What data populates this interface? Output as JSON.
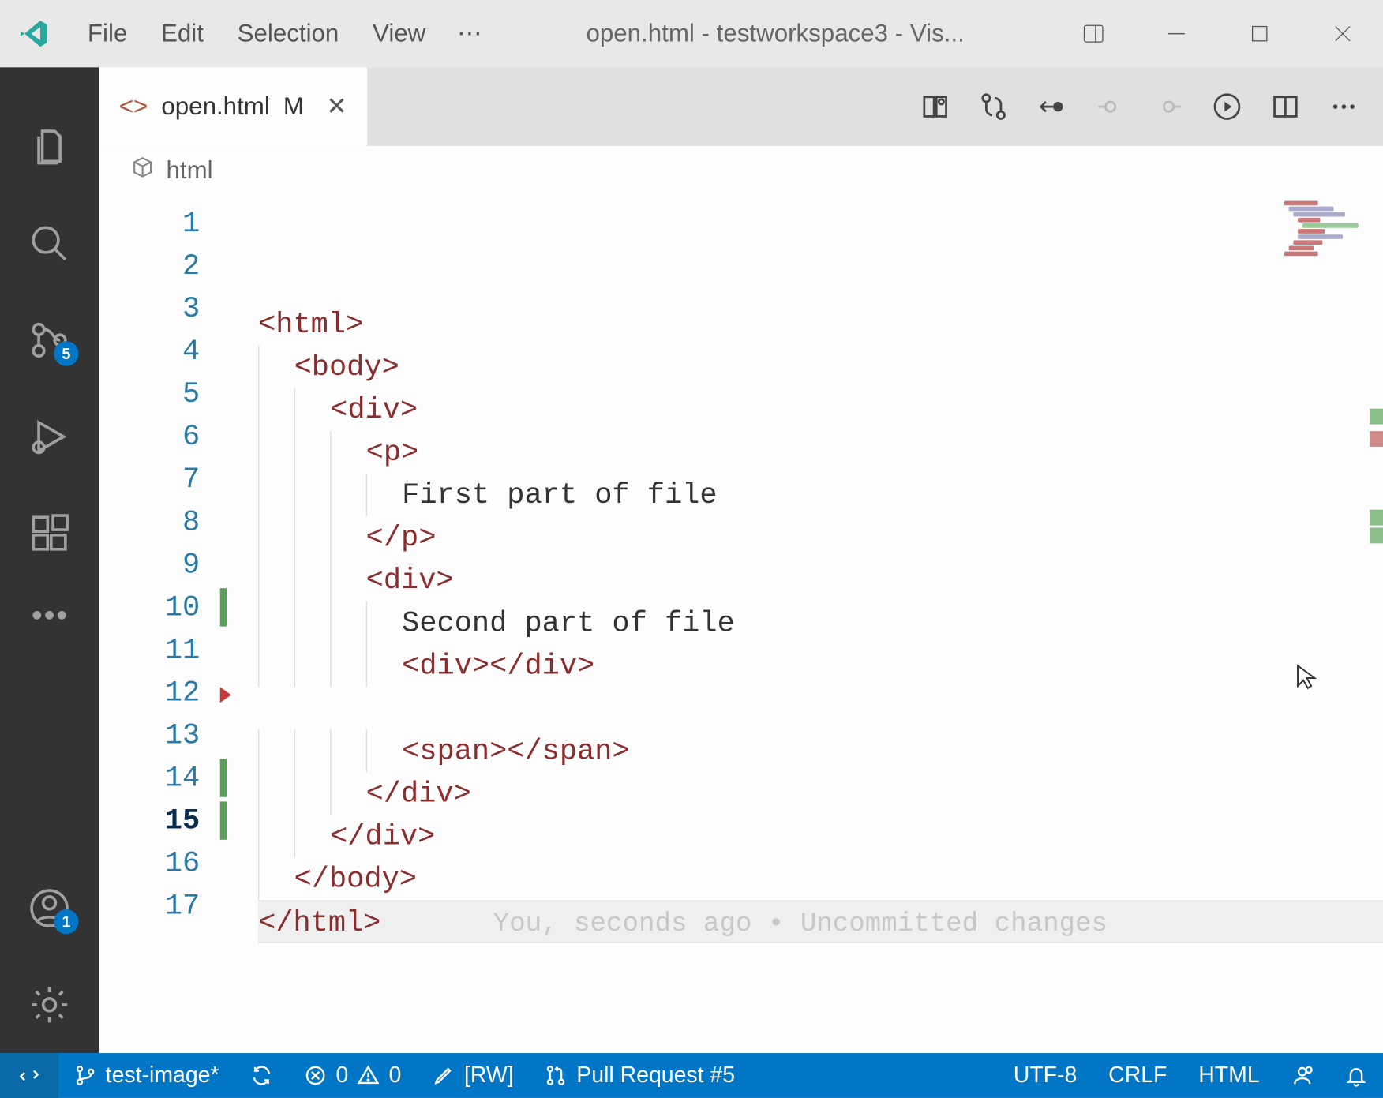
{
  "window": {
    "title": "open.html - testworkspace3 - Vis..."
  },
  "menu": {
    "file": "File",
    "edit": "Edit",
    "selection": "Selection",
    "view": "View",
    "more": "⋯"
  },
  "tab": {
    "filename": "open.html",
    "modified_flag": "M",
    "close": "✕"
  },
  "breadcrumb": {
    "item1": "html"
  },
  "activity": {
    "scm_badge": "5",
    "account_badge": "1"
  },
  "editor": {
    "line_numbers": [
      "1",
      "2",
      "3",
      "4",
      "5",
      "6",
      "7",
      "8",
      "9",
      "10",
      "11",
      "12",
      "13",
      "14",
      "15",
      "16",
      "17"
    ],
    "current_line_index": 14,
    "green_lines": [
      9,
      13,
      14
    ],
    "red_tri_lines": [
      11
    ],
    "lines": [
      {
        "indent": 0,
        "tokens": [
          {
            "t": "tag",
            "v": "<html>"
          }
        ]
      },
      {
        "indent": 1,
        "tokens": [
          {
            "t": "tag",
            "v": "<body>"
          }
        ]
      },
      {
        "indent": 2,
        "tokens": [
          {
            "t": "tag",
            "v": "<div>"
          }
        ]
      },
      {
        "indent": 3,
        "tokens": [
          {
            "t": "tag",
            "v": "<p>"
          }
        ]
      },
      {
        "indent": 4,
        "tokens": [
          {
            "t": "txt",
            "v": "First part of file"
          }
        ]
      },
      {
        "indent": 3,
        "tokens": [
          {
            "t": "tag",
            "v": "</p>"
          }
        ]
      },
      {
        "indent": 3,
        "tokens": [
          {
            "t": "tag",
            "v": "<div>"
          }
        ]
      },
      {
        "indent": 4,
        "tokens": [
          {
            "t": "txt",
            "v": "Second part of file"
          }
        ]
      },
      {
        "indent": 4,
        "tokens": [
          {
            "t": "tag",
            "v": "<div></div>"
          }
        ]
      },
      {
        "indent": 0,
        "tokens": []
      },
      {
        "indent": 4,
        "tokens": [
          {
            "t": "tag",
            "v": "<span></span>"
          }
        ]
      },
      {
        "indent": 3,
        "tokens": [
          {
            "t": "tag",
            "v": "</div>"
          }
        ]
      },
      {
        "indent": 2,
        "tokens": [
          {
            "t": "tag",
            "v": "</div>"
          }
        ]
      },
      {
        "indent": 1,
        "tokens": [
          {
            "t": "tag",
            "v": "</body>"
          }
        ]
      },
      {
        "indent": 0,
        "tokens": [
          {
            "t": "tag",
            "v": "</html>"
          }
        ],
        "blame": "You, seconds ago • Uncommitted changes"
      },
      {
        "indent": 0,
        "tokens": []
      },
      {
        "indent": 0,
        "tokens": []
      }
    ]
  },
  "status": {
    "branch": "test-image*",
    "errors": "0",
    "warnings": "0",
    "readwrite": "[RW]",
    "pr": "Pull Request #5",
    "encoding": "UTF-8",
    "eol": "CRLF",
    "language": "HTML"
  }
}
